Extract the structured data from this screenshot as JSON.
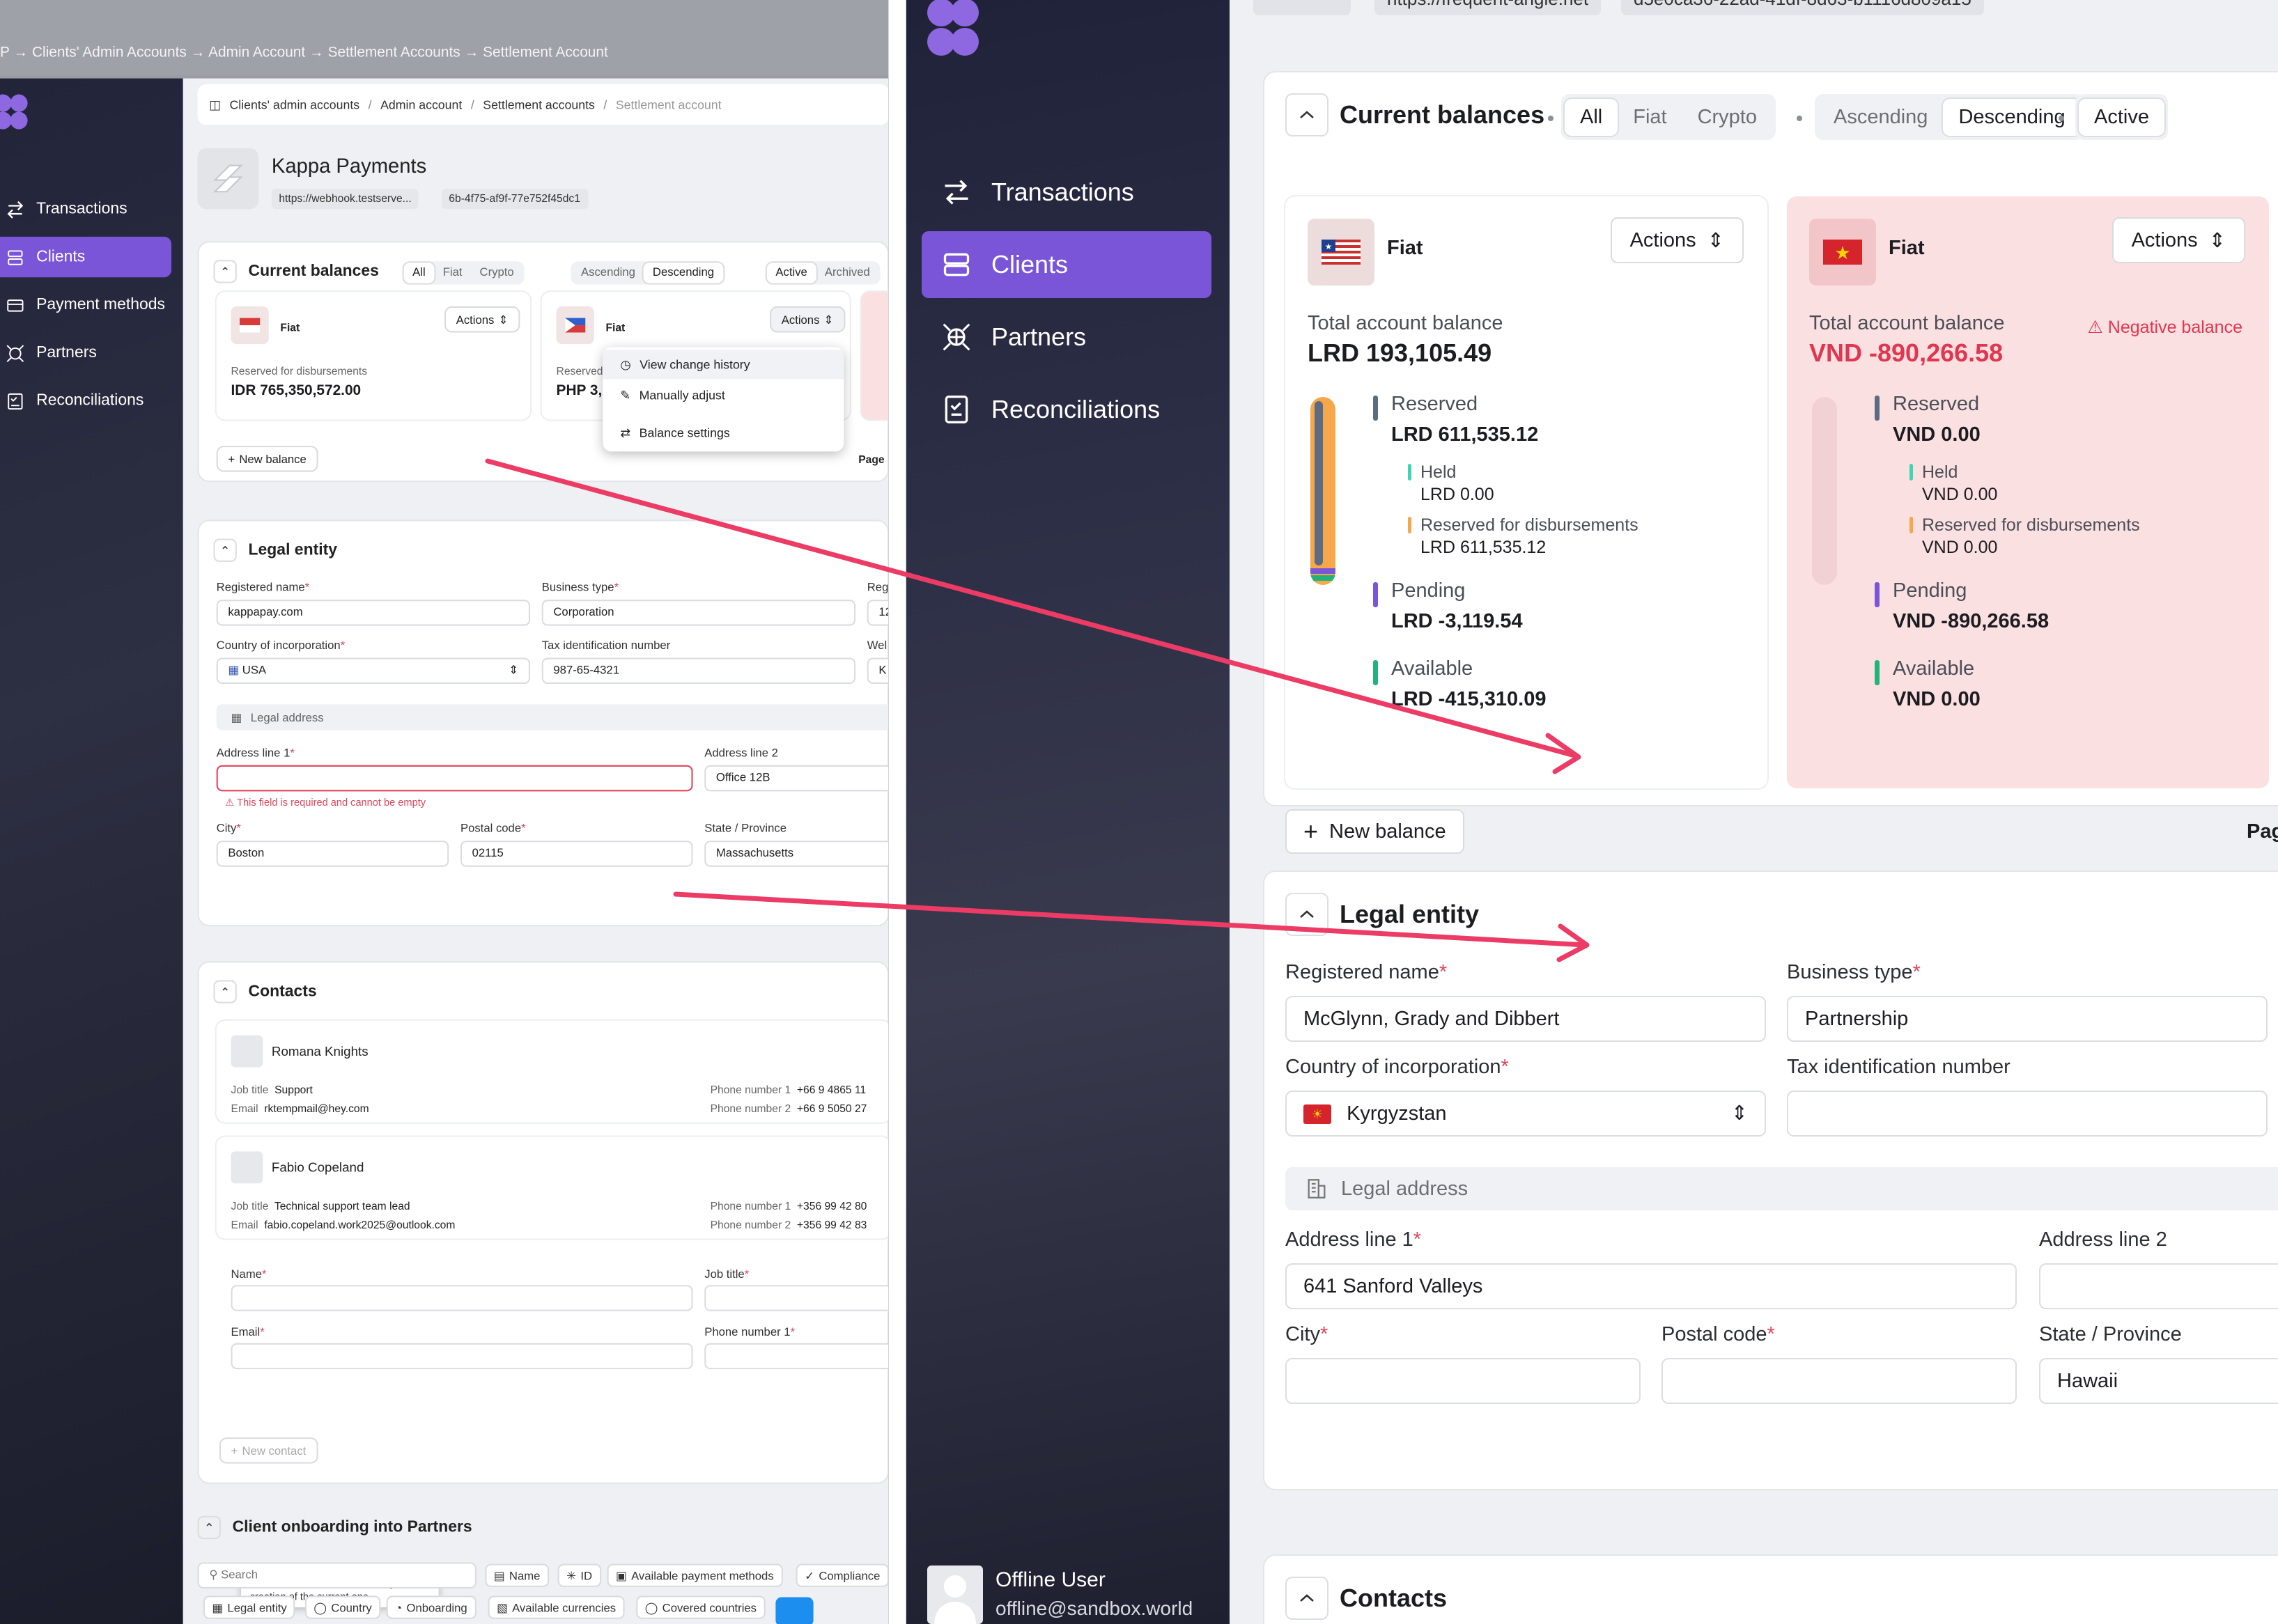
{
  "left": {
    "top_crumbs": "P → Clients' Admin Accounts → Admin Account → Settlement Accounts → Settlement Account",
    "nav": [
      {
        "label": "Transactions",
        "active": false
      },
      {
        "label": "Clients",
        "active": true
      },
      {
        "label": "Payment methods",
        "active": false
      },
      {
        "label": "Partners",
        "active": false
      },
      {
        "label": "Reconciliations",
        "active": false
      }
    ],
    "breadcrumb": [
      "Clients' admin accounts",
      "Admin account",
      "Settlement accounts",
      "Settlement account"
    ],
    "entity": {
      "name": "Kappa Payments",
      "url": "https://webhook.testserve...",
      "id": "6b-4f75-af9f-77e752f45dc1"
    },
    "balances": {
      "title": "Current balances",
      "filters": [
        "All",
        "Fiat",
        "Crypto"
      ],
      "sorts": [
        "Ascending",
        "Descending"
      ],
      "states": [
        "Active",
        "Archived"
      ],
      "cards": [
        {
          "type": "Fiat",
          "actions": "Actions",
          "label": "Reserved for disbursements",
          "value": "IDR 765,350,572.00"
        },
        {
          "type": "Fiat",
          "actions": "Actions",
          "label": "Reserved",
          "value": "PHP 3,"
        }
      ],
      "menu": [
        "View change history",
        "Manually adjust",
        "Balance settings"
      ],
      "new_balance": "New balance",
      "page": "Page"
    },
    "legal": {
      "title": "Legal entity",
      "registered_name_label": "Registered name",
      "registered_name": "kappapay.com",
      "business_type_label": "Business type",
      "business_type": "Corporation",
      "reg_label": "Reg",
      "reg_value": "12",
      "country_label": "Country of incorporation",
      "country": "USA",
      "tax_label": "Tax identification number",
      "tax": "987-65-4321",
      "web_label": "Wel",
      "web_value": "K",
      "legal_address": "Legal address",
      "address1_label": "Address line 1",
      "address1_error": "This field is required and cannot be empty",
      "address2_label": "Address line 2",
      "address2": "Office 12B",
      "city_label": "City",
      "city": "Boston",
      "postal_label": "Postal code",
      "postal": "02115",
      "state_label": "State / Province",
      "state": "Massachusetts"
    },
    "contacts": {
      "title": "Contacts",
      "people": [
        {
          "name": "Romana Knights",
          "job_title": "Support",
          "email": "rktempmail@hey.com",
          "phone1": "+66 9 4865 11",
          "phone2": "+66 9 5050 27"
        },
        {
          "name": "Fabio Copeland",
          "job_title": "Technical support team lead",
          "email": "fabio.copeland.work2025@outlook.com",
          "phone1": "+356 99 42 80",
          "phone2": "+356 99 42 83"
        }
      ],
      "job_title_label": "Job title",
      "email_label": "Email",
      "phone1_label": "Phone number 1",
      "phone2_label": "Phone number 2",
      "form": {
        "name": "Name",
        "job": "Job title",
        "email": "Email",
        "phone": "Phone number 1"
      },
      "tooltip": "To add a new contact, first complete the creation of the current one",
      "new_contact": "New contact"
    },
    "onboarding": {
      "title": "Client onboarding into Partners",
      "search_placeholder": "Search",
      "chips_row1": [
        "Name",
        "ID",
        "Available payment methods",
        "Compliance"
      ],
      "chips_row2": [
        "Legal entity",
        "Country",
        "Onboarding",
        "Available currencies",
        "Covered countries"
      ]
    }
  },
  "right": {
    "top_chips": [
      "https://frequent-angle.net",
      "d5e0ca36-22ad-41df-8d63-b1116d809a15"
    ],
    "nav": [
      {
        "label": "Transactions",
        "active": false
      },
      {
        "label": "Clients",
        "active": true
      },
      {
        "label": "Partners",
        "active": false
      },
      {
        "label": "Reconciliations",
        "active": false
      }
    ],
    "user": {
      "name": "Offline User",
      "email": "offline@sandbox.world"
    },
    "balances": {
      "title": "Current balances",
      "filters": [
        "All",
        "Fiat",
        "Crypto"
      ],
      "sorts": [
        "Ascending",
        "Descending"
      ],
      "state": "Active",
      "cards": [
        {
          "type": "Fiat",
          "actions": "Actions",
          "total_label": "Total account balance",
          "total": "LRD 193,105.49",
          "reserved_label": "Reserved",
          "reserved": "LRD 611,535.12",
          "held_label": "Held",
          "held": "LRD 0.00",
          "rfd_label": "Reserved for disbursements",
          "rfd": "LRD 611,535.12",
          "pending_label": "Pending",
          "pending": "LRD -3,119.54",
          "available_label": "Available",
          "available": "LRD -415,310.09"
        },
        {
          "type": "Fiat",
          "actions": "Actions",
          "total_label": "Total account balance",
          "total": "VND -890,266.58",
          "negative_note": "Negative balance",
          "reserved_label": "Reserved",
          "reserved": "VND 0.00",
          "held_label": "Held",
          "held": "VND 0.00",
          "rfd_label": "Reserved for disbursements",
          "rfd": "VND 0.00",
          "pending_label": "Pending",
          "pending": "VND -890,266.58",
          "available_label": "Available",
          "available": "VND 0.00"
        }
      ],
      "new_balance": "New balance",
      "page": "Pag"
    },
    "legal": {
      "title": "Legal entity",
      "registered_name_label": "Registered name",
      "registered_name": "McGlynn, Grady and Dibbert",
      "business_type_label": "Business type",
      "business_type": "Partnership",
      "country_label": "Country of incorporation",
      "country": "Kyrgyzstan",
      "tax_label": "Tax identification number",
      "tax": "",
      "legal_address": "Legal address",
      "address1_label": "Address line 1",
      "address1": "641 Sanford Valleys",
      "address2_label": "Address line 2",
      "address2": "",
      "city_label": "City",
      "city": "",
      "postal_label": "Postal code",
      "postal": "",
      "state_label": "State / Province",
      "state": "Hawaii"
    },
    "contacts": {
      "title": "Contacts"
    }
  },
  "colors": {
    "accent": "#7a55d8",
    "annotation_arrow": "#ec3b64",
    "error": "#e0364f",
    "reserved_marker": "#5d6b82",
    "held_marker": "#3fd4b4",
    "rfd_marker": "#f5a74a",
    "pending_marker": "#7a55d8",
    "available_marker": "#22b37a"
  }
}
